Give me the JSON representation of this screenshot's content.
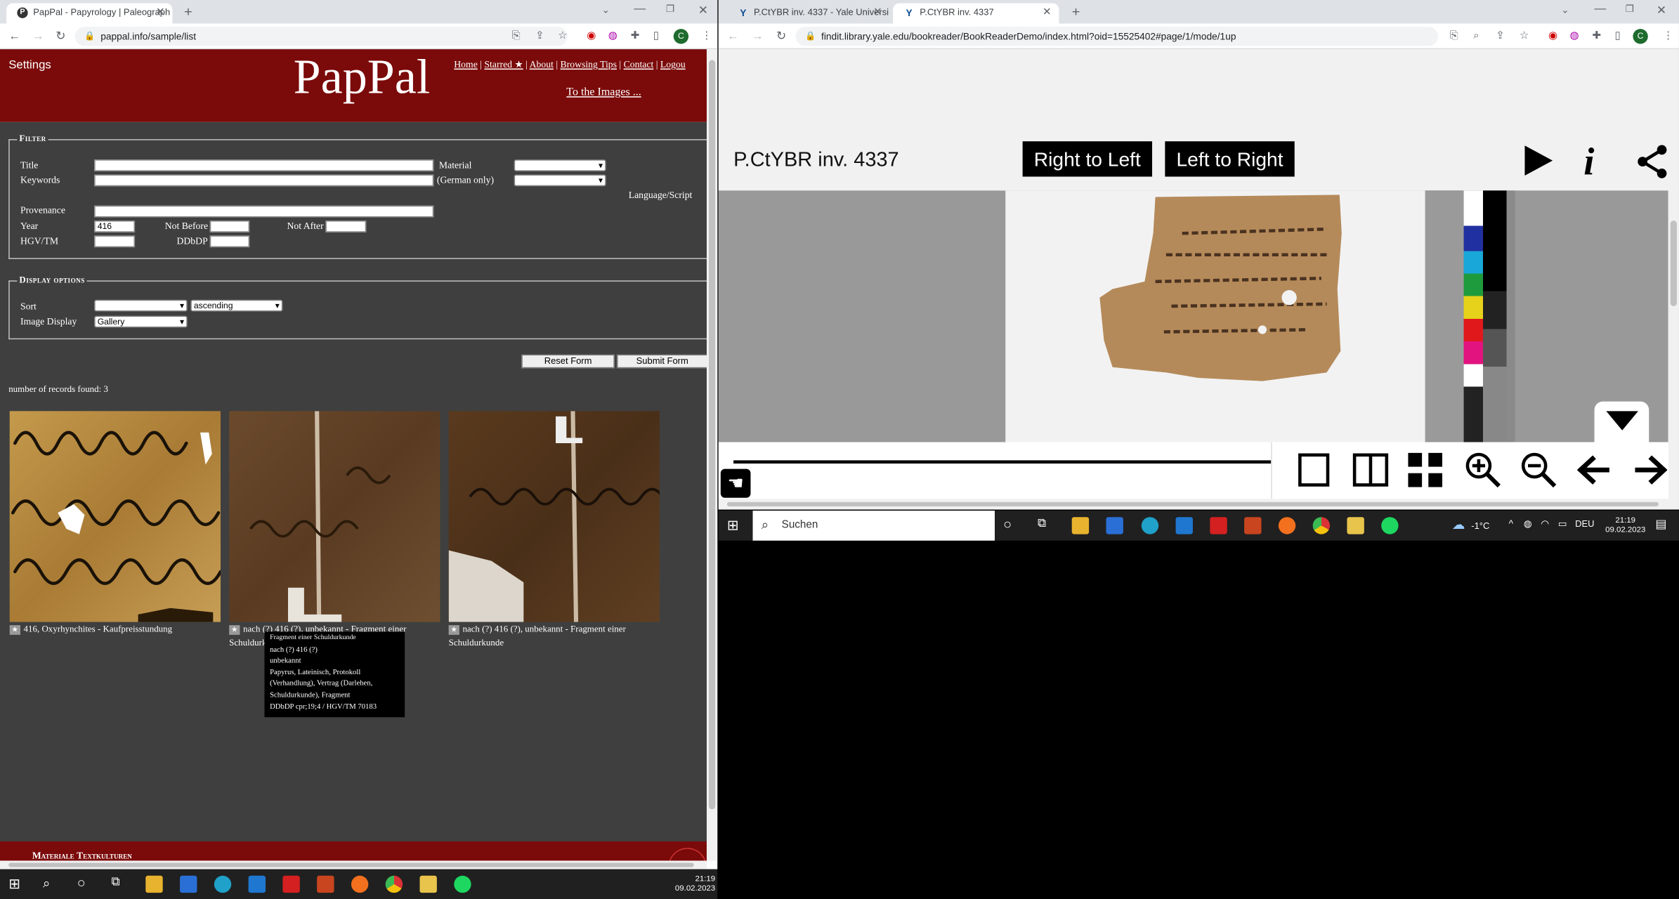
{
  "left_browser": {
    "tabs": [
      {
        "title": "PapPal - Papyrology | Paleograph",
        "active": true
      }
    ],
    "url": "pappal.info/sample/list",
    "header": {
      "settings": "Settings",
      "logo": "PapPal",
      "links": [
        "Home",
        "Starred ★",
        "About",
        "Browsing Tips",
        "Contact",
        "Logou"
      ],
      "to_images": "To the Images ..."
    },
    "filter": {
      "legend": "Filter",
      "title_label": "Title",
      "keywords_label": "Keywords",
      "material_label": "Material",
      "german_only": "(German only)",
      "language_label": "Language/Script",
      "provenance_label": "Provenance",
      "year_label": "Year",
      "year_value": "416",
      "not_before_label": "Not Before",
      "not_after_label": "Not After",
      "hgv_label": "HGV/TM",
      "ddbdp_label": "DDbDP"
    },
    "display": {
      "legend": "Display options",
      "sort_label": "Sort",
      "sort_order": "ascending",
      "image_display_label": "Image Display",
      "image_display_value": "Gallery"
    },
    "reset_button": "Reset Form",
    "submit_button": "Submit Form",
    "records_found": "number of records found: 3",
    "results": [
      {
        "caption": "416, Oxyrhynchites - Kaufpreisstundung"
      },
      {
        "caption": "nach (?) 416 (?), unbekannt - Fragment einer Schuldurkunde"
      },
      {
        "caption": "nach (?) 416 (?), unbekannt - Fragment einer Schuldurkunde"
      }
    ],
    "tooltip": [
      "Fragment einer Schuldurkunde",
      "nach (?) 416 (?)",
      "unbekannt",
      "Papyrus, Lateinisch, Protokoll",
      "(Verhandlung), Vertrag (Darlehen,",
      "Schuldurkunde), Fragment",
      "DDbDP cpr;19;4 / HGV/TM 70183"
    ],
    "footer_text": "Materiale Textkulturen",
    "taskbar": {
      "time": "21:19",
      "date": "09.02.2023"
    }
  },
  "right_browser": {
    "tabs": [
      {
        "title": "P.CtYBR inv. 4337 - Yale Universi",
        "active": false
      },
      {
        "title": "P.CtYBR inv. 4337",
        "active": true
      }
    ],
    "url": "findit.library.yale.edu/bookreader/BookReaderDemo/index.html?oid=15525402#page/1/mode/1up",
    "viewer": {
      "title": "P.CtYBR inv. 4337",
      "rtl_button": "Right to Left",
      "ltr_button": "Left to Right"
    },
    "taskbar": {
      "search_placeholder": "Suchen",
      "weather": "-1°C",
      "language": "DEU",
      "time": "21:19",
      "date": "09.02.2023"
    }
  },
  "colors": {
    "pappal_red": "#7b0a0a",
    "pappal_body": "#3f3f3f",
    "chrome_tab": "#dee1e6",
    "taskbar": "#202020"
  }
}
